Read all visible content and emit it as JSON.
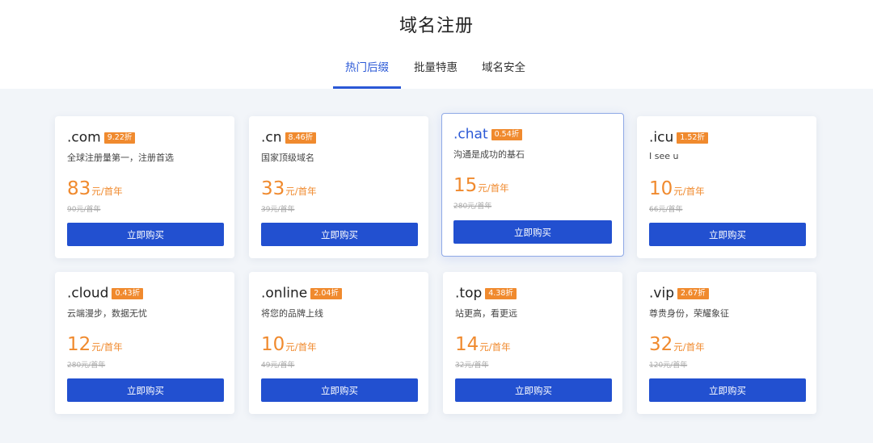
{
  "page": {
    "title": "域名注册"
  },
  "tabs": [
    {
      "label": "热门后缀",
      "active": true
    },
    {
      "label": "批量特惠",
      "active": false
    },
    {
      "label": "域名安全",
      "active": false
    }
  ],
  "colors": {
    "accent": "#2a58d6",
    "button": "#2250d0",
    "price": "#f08a2e",
    "badge": "#f08a2e"
  },
  "domains": [
    {
      "name": ".com",
      "discount": "9.22折",
      "desc": "全球注册量第一，注册首选",
      "price": "83",
      "unit": "元/首年",
      "original": "90元/首年",
      "button": "立即购买",
      "featured": false
    },
    {
      "name": ".cn",
      "discount": "8.46折",
      "desc": "国家顶级域名",
      "price": "33",
      "unit": "元/首年",
      "original": "39元/首年",
      "button": "立即购买",
      "featured": false
    },
    {
      "name": ".chat",
      "discount": "0.54折",
      "desc": "沟通是成功的基石",
      "price": "15",
      "unit": "元/首年",
      "original": "280元/首年",
      "button": "立即购买",
      "featured": true
    },
    {
      "name": ".icu",
      "discount": "1.52折",
      "desc": "I see u",
      "price": "10",
      "unit": "元/首年",
      "original": "66元/首年",
      "button": "立即购买",
      "featured": false
    },
    {
      "name": ".cloud",
      "discount": "0.43折",
      "desc": "云端漫步，数据无忧",
      "price": "12",
      "unit": "元/首年",
      "original": "280元/首年",
      "button": "立即购买",
      "featured": false
    },
    {
      "name": ".online",
      "discount": "2.04折",
      "desc": "将您的品牌上线",
      "price": "10",
      "unit": "元/首年",
      "original": "49元/首年",
      "button": "立即购买",
      "featured": false
    },
    {
      "name": ".top",
      "discount": "4.38折",
      "desc": "站更高，看更远",
      "price": "14",
      "unit": "元/首年",
      "original": "32元/首年",
      "button": "立即购买",
      "featured": false
    },
    {
      "name": ".vip",
      "discount": "2.67折",
      "desc": "尊贵身份，荣耀象征",
      "price": "32",
      "unit": "元/首年",
      "original": "120元/首年",
      "button": "立即购买",
      "featured": false
    }
  ]
}
